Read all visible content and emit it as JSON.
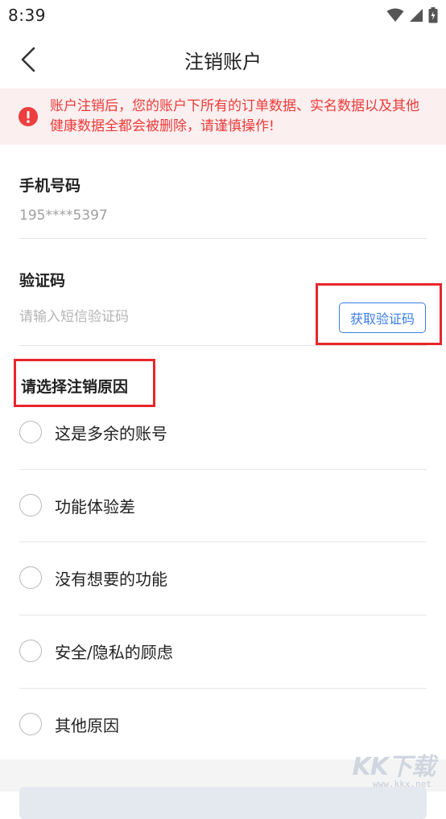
{
  "status_bar": {
    "time": "8:39"
  },
  "nav": {
    "title": "注销账户"
  },
  "warning": {
    "text": "账户注销后，您的账户下所有的订单数据、实名数据以及其他健康数据全都会被删除，请谨慎操作!"
  },
  "phone": {
    "label": "手机号码",
    "value": "195****5397"
  },
  "code": {
    "label": "验证码",
    "placeholder": "请输入短信验证码",
    "button": "获取验证码"
  },
  "reasons": {
    "title": "请选择注销原因",
    "items": [
      {
        "label": "这是多余的账号"
      },
      {
        "label": "功能体验差"
      },
      {
        "label": "没有想要的功能"
      },
      {
        "label": "安全/隐私的顾虑"
      },
      {
        "label": "其他原因"
      }
    ]
  },
  "watermark": {
    "main": "KK下载",
    "sub": "www.kkx.net"
  },
  "colors": {
    "warning_red": "#ed3b3b",
    "accent_blue": "#3b7ee9",
    "highlight_red": "#e8262b"
  }
}
